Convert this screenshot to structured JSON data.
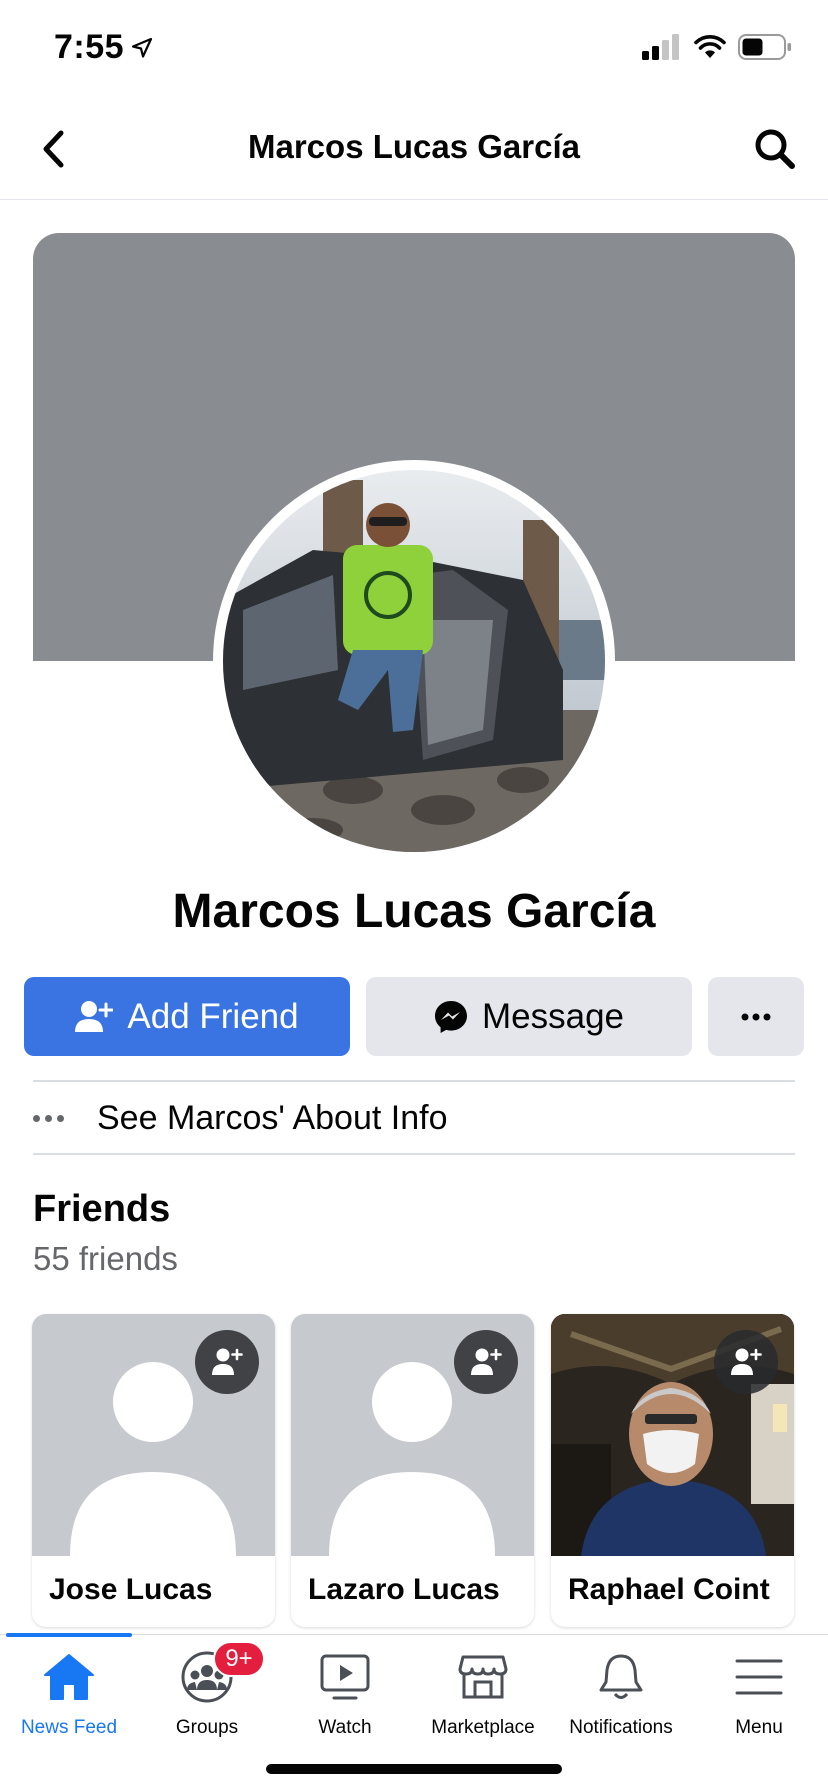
{
  "status_bar": {
    "time": "7:55",
    "icons": [
      "location-arrow-icon",
      "signal-icon",
      "wifi-icon",
      "battery-icon"
    ]
  },
  "nav": {
    "title": "Marcos Lucas García",
    "back_icon": "chevron-left-icon",
    "search_icon": "search-icon"
  },
  "profile": {
    "name": "Marcos Lucas García",
    "cover_color": "#898c90"
  },
  "actions": {
    "add_friend_label": "Add Friend",
    "message_label": "Message",
    "more_icon": "ellipsis-icon",
    "add_friend_color": "#3a73e2"
  },
  "about": {
    "label": "See Marcos' About Info"
  },
  "friends": {
    "heading": "Friends",
    "count": "55 friends",
    "items": [
      {
        "name": "Jose Lucas",
        "photo": "default-avatar"
      },
      {
        "name": "Lazaro Lucas",
        "photo": "default-avatar"
      },
      {
        "name": "Raphael Coint",
        "photo": "photo"
      }
    ]
  },
  "tab_bar": {
    "active_color": "#1877f2",
    "badge_color": "#e41e3f",
    "tabs": [
      {
        "label": "News Feed",
        "icon": "home-icon",
        "active": true
      },
      {
        "label": "Groups",
        "icon": "groups-icon",
        "badge": "9+"
      },
      {
        "label": "Watch",
        "icon": "watch-icon"
      },
      {
        "label": "Marketplace",
        "icon": "marketplace-icon"
      },
      {
        "label": "Notifications",
        "icon": "bell-icon"
      },
      {
        "label": "Menu",
        "icon": "hamburger-icon"
      }
    ]
  }
}
